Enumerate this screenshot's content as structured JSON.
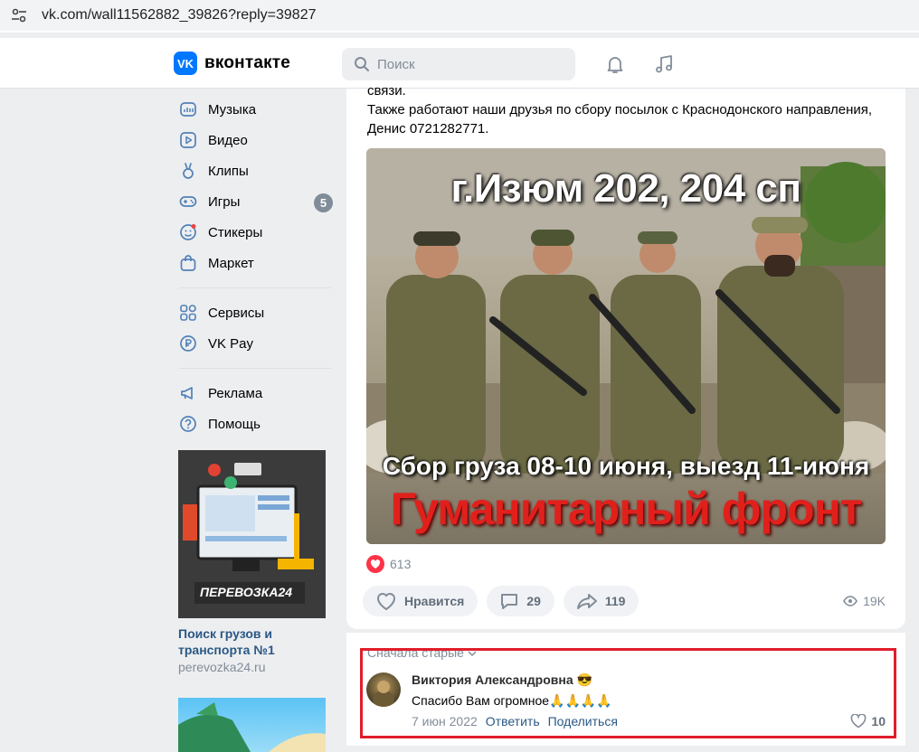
{
  "browser": {
    "url": "vk.com/wall11562882_39826?reply=39827"
  },
  "header": {
    "logo_text": "вконтакте",
    "logo_badge": "VK",
    "search_placeholder": "Поиск",
    "accent": "#0077ff"
  },
  "sidebar": {
    "items": [
      {
        "label": "Музыка",
        "icon": "music-icon"
      },
      {
        "label": "Видео",
        "icon": "video-icon"
      },
      {
        "label": "Клипы",
        "icon": "clips-icon"
      },
      {
        "label": "Игры",
        "icon": "games-icon",
        "badge": "5"
      },
      {
        "label": "Стикеры",
        "icon": "stickers-icon"
      },
      {
        "label": "Маркет",
        "icon": "market-icon"
      },
      {
        "label": "Сервисы",
        "icon": "services-icon"
      },
      {
        "label": "VK Pay",
        "icon": "vkpay-icon"
      },
      {
        "label": "Реклама",
        "icon": "ads-icon"
      },
      {
        "label": "Помощь",
        "icon": "help-icon"
      }
    ],
    "ad": {
      "brand": "ПЕРЕВОЗКА24",
      "title": "Поиск грузов и транспорта №1",
      "domain": "perevozka24.ru"
    }
  },
  "post": {
    "text_line0": "связи.",
    "text_line1": "Также работают наши друзья по сбору посылок с Краснодонского направления,",
    "text_line2": "Денис 0721282771.",
    "image": {
      "headline": "г.Изюм 202, 204 сп",
      "subline": "Сбор груза  08-10 июня, выезд 11-июня",
      "banner": "Гуманитарный фронт"
    },
    "reaction_count": "613",
    "like_label": "Нравится",
    "comments_count": "29",
    "shares_count": "119",
    "views": "19K"
  },
  "comments": {
    "sort_label": "Сначала старые",
    "items": [
      {
        "author": "Виктория Александровна 😎",
        "text": "Спасибо Вам огромное🙏🙏🙏🙏",
        "date": "7 июн 2022",
        "reply_label": "Ответить",
        "share_label": "Поделиться",
        "likes": "10"
      }
    ],
    "highlight_color": "#e01e2b"
  }
}
